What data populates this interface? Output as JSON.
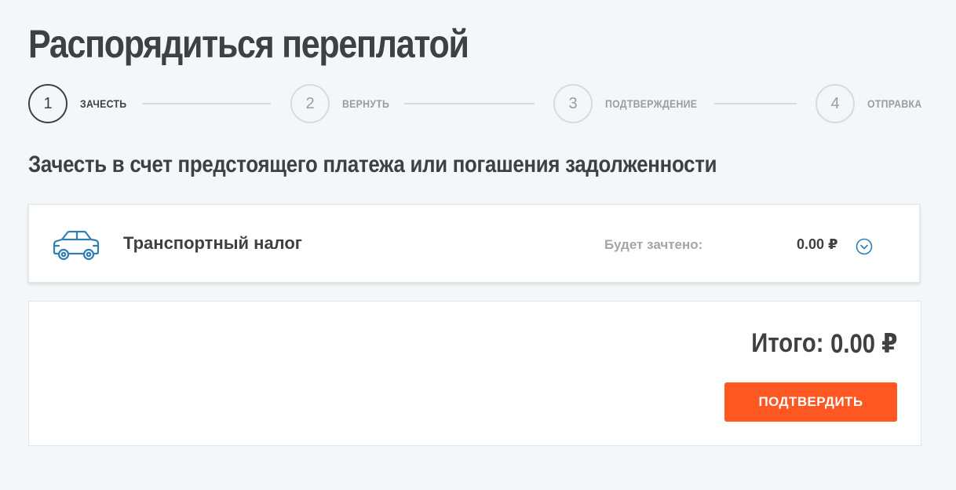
{
  "page": {
    "title": "Распорядиться переплатой"
  },
  "stepper": {
    "steps": [
      {
        "number": "1",
        "label": "ЗАЧЕСТЬ",
        "active": true
      },
      {
        "number": "2",
        "label": "ВЕРНУТЬ",
        "active": false
      },
      {
        "number": "3",
        "label": "ПОДТВЕРЖДЕНИЕ",
        "active": false
      },
      {
        "number": "4",
        "label": "ОТПРАВКА",
        "active": false
      }
    ]
  },
  "section": {
    "title": "Зачесть в счет предстоящего платежа или погашения задолженности"
  },
  "tax_item": {
    "icon": "car-icon",
    "name": "Транспортный налог",
    "credit_label": "Будет зачтено:",
    "credit_value": "0.00 ₽",
    "expand_icon": "chevron-down-circle-icon"
  },
  "summary": {
    "total_label": "Итого:",
    "total_value": "0.00 ₽",
    "confirm_label": "ПОДТВЕРДИТЬ"
  },
  "colors": {
    "background": "#f4f7f9",
    "text": "#3f4042",
    "muted": "#9a9ca0",
    "accent_orange": "#fe5722",
    "icon_blue": "#2f7fb5"
  }
}
